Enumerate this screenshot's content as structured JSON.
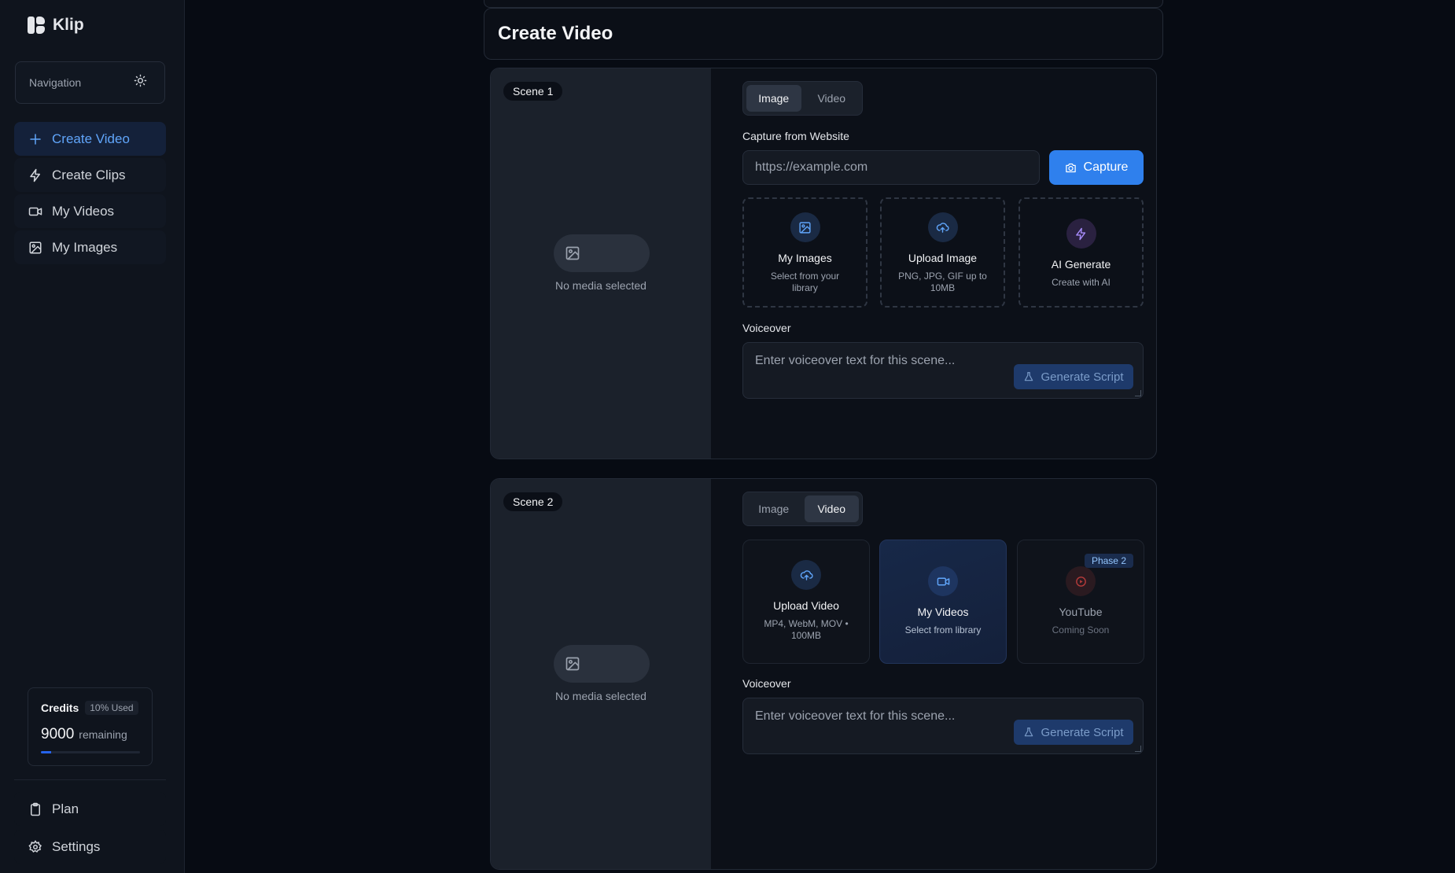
{
  "app": {
    "name": "Klip"
  },
  "sidebar": {
    "nav_label": "Navigation",
    "items": [
      {
        "label": "Create Video",
        "icon": "plus-icon",
        "active": true
      },
      {
        "label": "Create Clips",
        "icon": "zap-icon",
        "active": false
      },
      {
        "label": "My Videos",
        "icon": "video-icon",
        "active": false
      },
      {
        "label": "My Images",
        "icon": "image-icon",
        "active": false
      }
    ],
    "credits": {
      "title": "Credits",
      "badge": "10% Used",
      "amount": "9000",
      "remaining_label": "remaining",
      "used_fraction": 0.1
    },
    "bottom": [
      {
        "label": "Plan",
        "icon": "clipboard-icon"
      },
      {
        "label": "Settings",
        "icon": "gear-icon"
      }
    ]
  },
  "page": {
    "title": "Create Video"
  },
  "scenes": [
    {
      "badge": "Scene 1",
      "no_media": "No media selected",
      "tabs": [
        "Image",
        "Video"
      ],
      "active_tab": "Image",
      "capture_label": "Capture from Website",
      "url_placeholder": "https://example.com",
      "capture_button": "Capture",
      "options": [
        {
          "title": "My Images",
          "subtitle": "Select from your library",
          "icon": "image-icon"
        },
        {
          "title": "Upload Image",
          "subtitle": "PNG, JPG, GIF up to 10MB",
          "icon": "upload-cloud-icon"
        },
        {
          "title": "AI Generate",
          "subtitle": "Create with AI",
          "icon": "zap-icon"
        }
      ],
      "voiceover_label": "Voiceover",
      "voiceover_placeholder": "Enter voiceover text for this scene...",
      "generate_button": "Generate Script"
    },
    {
      "badge": "Scene 2",
      "no_media": "No media selected",
      "tabs": [
        "Image",
        "Video"
      ],
      "active_tab": "Video",
      "options": [
        {
          "title": "Upload Video",
          "subtitle": "MP4, WebM, MOV • 100MB",
          "icon": "upload-cloud-icon"
        },
        {
          "title": "My Videos",
          "subtitle": "Select from library",
          "icon": "video-icon"
        },
        {
          "title": "YouTube",
          "subtitle": "Coming Soon",
          "icon": "youtube-icon",
          "badge": "Phase 2"
        }
      ],
      "voiceover_label": "Voiceover",
      "voiceover_placeholder": "Enter voiceover text for this scene...",
      "generate_button": "Generate Script"
    }
  ],
  "colors": {
    "accent": "#2f80ed",
    "active_nav_text": "#60a5fa",
    "ai_purple": "#a78bfa",
    "youtube_red": "#ef4444"
  }
}
